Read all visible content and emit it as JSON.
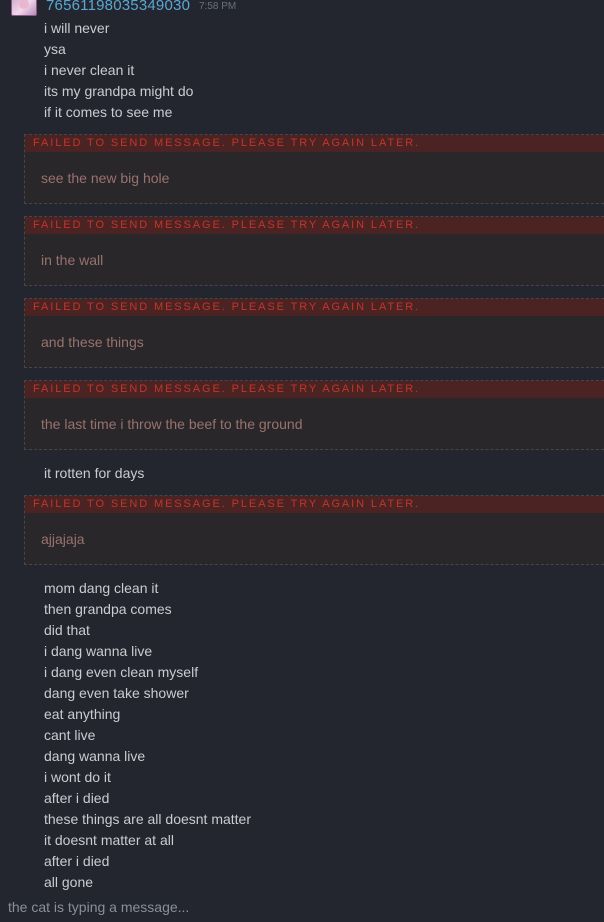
{
  "header": {
    "username": "76561198035349030",
    "timestamp": "7:58 PM"
  },
  "messages_top": [
    "i will never",
    "ysa",
    "i never clean it",
    "its my grandpa might do",
    "if it comes to see me"
  ],
  "error_label": "FAILED TO SEND MESSAGE. PLEASE TRY AGAIN LATER.",
  "failed": [
    "see the new big hole",
    "in the wall",
    "and these things",
    "the last time i throw the beef to the ground",
    "ajjajaja"
  ],
  "message_middle": "it rotten for days",
  "messages_bottom": [
    "mom dang clean it",
    "then grandpa comes",
    "did that",
    "i dang wanna live",
    "i dang even clean myself",
    "dang even take shower",
    "eat anything",
    "cant live",
    "dang wanna live",
    "i wont do it",
    "after i died",
    "these things are all doesnt matter",
    "it doesnt matter at all",
    "after i died",
    "all gone"
  ],
  "typing_indicator": "the cat is typing a message..."
}
